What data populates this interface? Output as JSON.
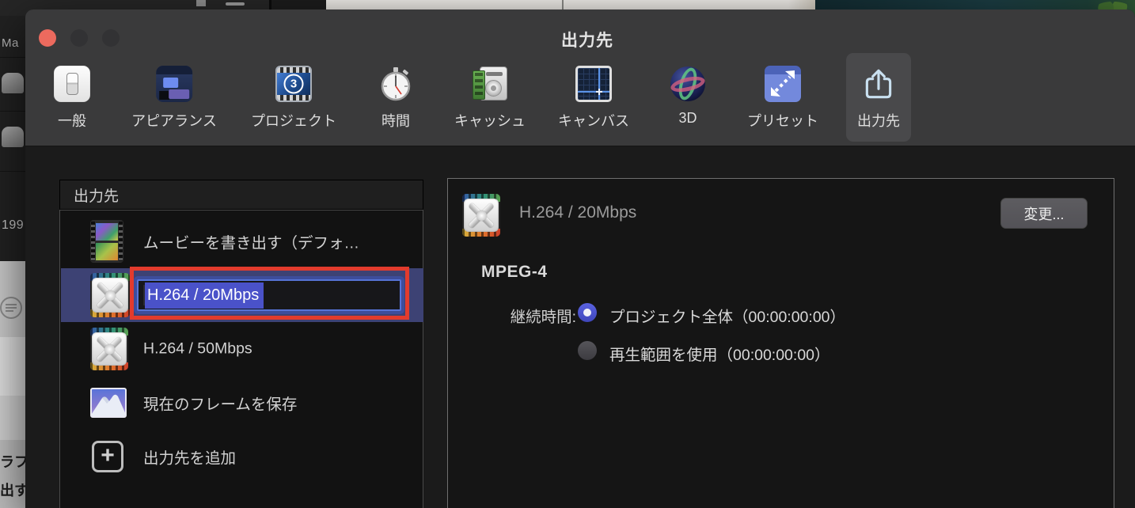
{
  "window": {
    "title": "出力先"
  },
  "toolbar": {
    "items": [
      {
        "label": "一般",
        "icon": "general-switch-icon",
        "selected": false
      },
      {
        "label": "アピアランス",
        "icon": "appearance-panels-icon",
        "selected": false
      },
      {
        "label": "プロジェクト",
        "icon": "project-clapper-icon",
        "selected": false
      },
      {
        "label": "時間",
        "icon": "time-stopwatch-icon",
        "selected": false
      },
      {
        "label": "キャッシュ",
        "icon": "cache-memory-disk-icon",
        "selected": false
      },
      {
        "label": "キャンバス",
        "icon": "canvas-grid-icon",
        "selected": false
      },
      {
        "label": "3D",
        "icon": "three-d-sphere-icon",
        "selected": false
      },
      {
        "label": "プリセット",
        "icon": "preset-resize-icon",
        "selected": false
      },
      {
        "label": "出力先",
        "icon": "destination-share-icon",
        "selected": true
      }
    ]
  },
  "sidebar": {
    "header": "出力先",
    "items": [
      {
        "label": "ムービーを書き出す（デフォ…",
        "icon": "movie-filmstrip-icon",
        "selected": false,
        "editing": false
      },
      {
        "label": "H.264 / 20Mbps",
        "icon": "compressor-setting-icon",
        "selected": true,
        "editing": true
      },
      {
        "label": "H.264 / 50Mbps",
        "icon": "compressor-setting-icon",
        "selected": false,
        "editing": false
      },
      {
        "label": "現在のフレームを保存",
        "icon": "current-frame-photo-icon",
        "selected": false,
        "editing": false
      },
      {
        "label": "出力先を追加",
        "icon": "add-destination-plus-icon",
        "selected": false,
        "editing": false
      }
    ]
  },
  "detail": {
    "title": "H.264 / 20Mbps",
    "change_button_label": "変更...",
    "format": "MPEG-4",
    "duration_label": "継続時間:",
    "duration_options": [
      {
        "label": "プロジェクト全体（00:00:00:00）",
        "selected": true
      },
      {
        "label": "再生範囲を使用（00:00:00:00）",
        "selected": false
      }
    ]
  },
  "background": {
    "left": {
      "top": "Ma",
      "number": "199",
      "bottom_line1": "ラフ",
      "bottom_line2": "出す"
    }
  },
  "colors": {
    "annotation_red": "#e23b2d",
    "selection_row": "#3d4274",
    "text_selection": "#4a52c9",
    "radio_selected": "#4a51c8",
    "toolbar_bg": "#3a3a3b",
    "dialog_bg": "#1b1b1b"
  }
}
